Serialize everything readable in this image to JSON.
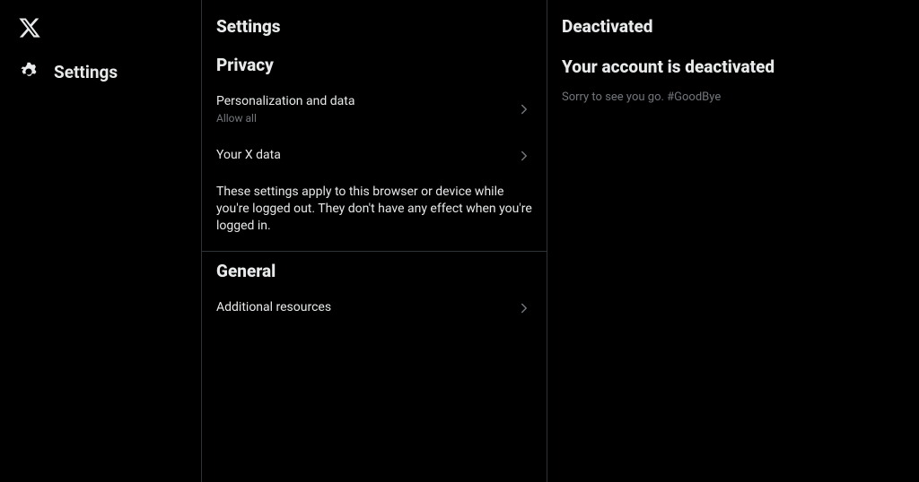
{
  "nav": {
    "settings_label": "Settings"
  },
  "middle": {
    "title": "Settings",
    "privacy": {
      "title": "Privacy",
      "personalization": {
        "label": "Personalization and data",
        "sub": "Allow all"
      },
      "your_data": {
        "label": "Your X data"
      },
      "note": "These settings apply to this browser or device while you're logged out. They don't have any effect when you're logged in."
    },
    "general": {
      "title": "General",
      "additional": {
        "label": "Additional resources"
      }
    }
  },
  "right": {
    "title": "Deactivated",
    "heading": "Your account is deactivated",
    "body": "Sorry to see you go. #GoodBye"
  }
}
